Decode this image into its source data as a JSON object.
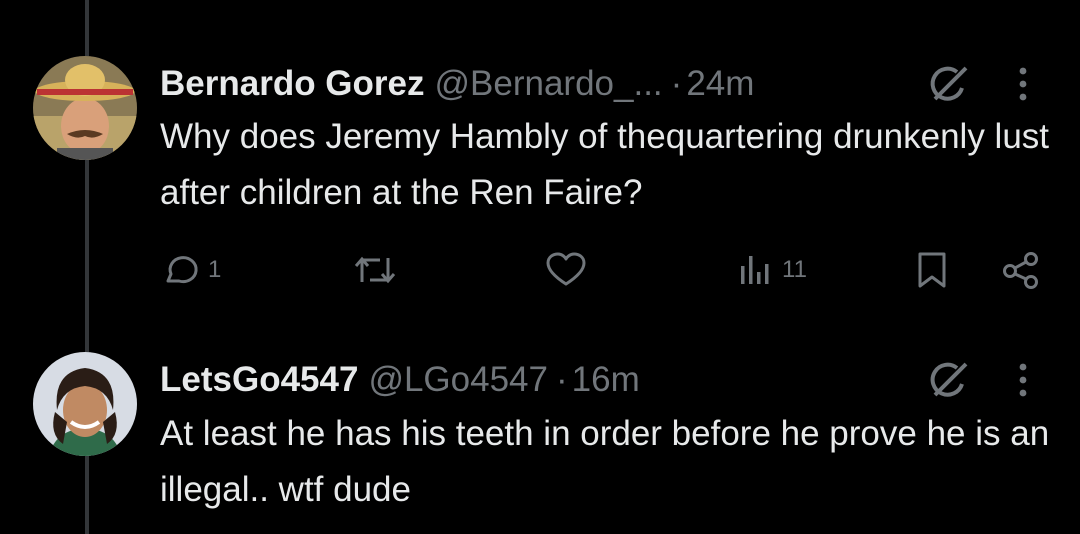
{
  "tweets": [
    {
      "display_name": "Bernardo Gorez",
      "handle": "@Bernardo_...",
      "separator": "·",
      "time": "24m",
      "text": "Why does Jeremy Hambly of thequartering drunkenly lust after children at the Ren Faire?",
      "actions": {
        "replies": "1",
        "views": "11"
      }
    },
    {
      "display_name": "LetsGo4547",
      "handle": "@LGo4547",
      "separator": "·",
      "time": "16m",
      "text": "At least he has his teeth in order before he prove he is an illegal.. wtf dude"
    }
  ],
  "icons": [
    "grok-icon",
    "more-icon",
    "reply-icon",
    "retweet-icon",
    "like-icon",
    "views-icon",
    "bookmark-icon",
    "share-icon"
  ],
  "colors": {
    "background": "#000000",
    "text": "#e7e9ea",
    "muted": "#71767b",
    "thread_line": "#333639"
  }
}
